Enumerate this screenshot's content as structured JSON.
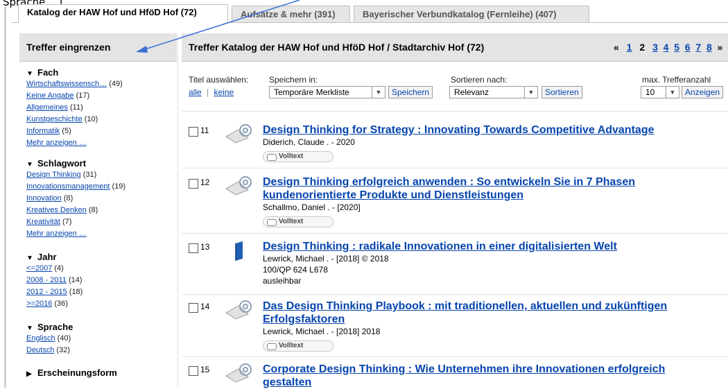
{
  "top_fragment": "Sprache ...)",
  "tabs": [
    {
      "label": "Katalog der HAW Hof und HföD Hof (72)"
    },
    {
      "label": "Aufsätze & mehr (391)"
    },
    {
      "label": "Bayerischer Verbundkatalog (Fernleihe) (407)"
    }
  ],
  "sidebar": {
    "title": "Treffer eingrenzen",
    "facets": [
      {
        "title": "Fach",
        "expanded": true,
        "items": [
          {
            "label": "Wirtschaftswissensch…",
            "count": "(49)"
          },
          {
            "label": "Keine Angabe",
            "count": "(17)"
          },
          {
            "label": "Allgemeines",
            "count": "(11)"
          },
          {
            "label": "Kunstgeschichte",
            "count": "(10)"
          },
          {
            "label": "Informatik",
            "count": "(5)"
          },
          {
            "label": "Mehr anzeigen …",
            "count": ""
          }
        ]
      },
      {
        "title": "Schlagwort",
        "expanded": true,
        "items": [
          {
            "label": "Design Thinking",
            "count": "(31)"
          },
          {
            "label": "Innovationsmanagement",
            "count": "(19)"
          },
          {
            "label": "Innovation",
            "count": "(8)"
          },
          {
            "label": "Kreatives Denken",
            "count": "(8)"
          },
          {
            "label": "Kreativität",
            "count": "(7)"
          },
          {
            "label": "Mehr anzeigen …",
            "count": ""
          }
        ]
      },
      {
        "title": "Jahr",
        "expanded": true,
        "items": [
          {
            "label": "<=2007",
            "count": "(4)"
          },
          {
            "label": "2008 - 2011",
            "count": "(14)"
          },
          {
            "label": "2012 - 2015",
            "count": "(18)"
          },
          {
            "label": ">=2016",
            "count": "(36)"
          }
        ]
      },
      {
        "title": "Sprache",
        "expanded": true,
        "items": [
          {
            "label": "Englisch",
            "count": "(40)"
          },
          {
            "label": "Deutsch",
            "count": "(32)"
          }
        ]
      },
      {
        "title": "Erscheinungsform",
        "expanded": false,
        "items": []
      }
    ]
  },
  "main": {
    "title": "Treffer Katalog der HAW Hof und HföD Hof / Stadtarchiv Hof (72)",
    "pager": {
      "prev": "«",
      "current": "2",
      "pages": [
        "1",
        "2",
        "3",
        "4",
        "5",
        "6",
        "7",
        "8"
      ],
      "next": "»"
    },
    "controls": {
      "select_label": "Titel auswählen:",
      "select_all": "alle",
      "select_none": "keine",
      "save_label": "Speichern in:",
      "save_target": "Temporäre Merkliste",
      "save_button": "Speichern",
      "sort_label": "Sortieren nach:",
      "sort_value": "Relevanz",
      "sort_button": "Sortieren",
      "max_label": "max. Trefferanzahl",
      "max_value": "10",
      "max_button": "Anzeigen"
    },
    "results": [
      {
        "num": "11",
        "icon": "online-resource-icon",
        "title_lines": [
          "Design Thinking for Strategy : Innovating Towards Competitive Advantage"
        ],
        "meta": [
          "Diderich, Claude . - 2020"
        ],
        "fulltext": "Volltext"
      },
      {
        "num": "12",
        "icon": "online-resource-icon",
        "title_lines": [
          "Design Thinking erfolgreich anwenden : So entwickeln Sie in 7 Phasen",
          "kundenorientierte Produkte und Dienstleistungen"
        ],
        "meta": [
          "Schallmo, Daniel . - [2020]"
        ],
        "fulltext": "Volltext"
      },
      {
        "num": "13",
        "icon": "book-icon",
        "title_lines": [
          "Design Thinking : radikale Innovationen in einer digitalisierten Welt"
        ],
        "meta": [
          "Lewrick, Michael . - [2018] © 2018",
          "100/QP 624 L678",
          "ausleihbar"
        ],
        "fulltext": ""
      },
      {
        "num": "14",
        "icon": "online-resource-icon",
        "title_lines": [
          "Das Design Thinking Playbook : mit traditionellen, aktuellen und zukünftigen",
          "Erfolgsfaktoren"
        ],
        "meta": [
          "Lewrick, Michael . - [2018] 2018"
        ],
        "fulltext": "Volltext"
      },
      {
        "num": "15",
        "icon": "online-resource-icon",
        "title_lines": [
          "Corporate Design Thinking : Wie Unternehmen ihre Innovationen erfolgreich",
          "gestalten"
        ],
        "meta": [],
        "fulltext": ""
      }
    ]
  },
  "colors": {
    "link": "#0645ad",
    "header_bg": "#e4e4e4",
    "annotation_arrow": "#3b6fd4",
    "book_icon": "#1f5fb5"
  }
}
